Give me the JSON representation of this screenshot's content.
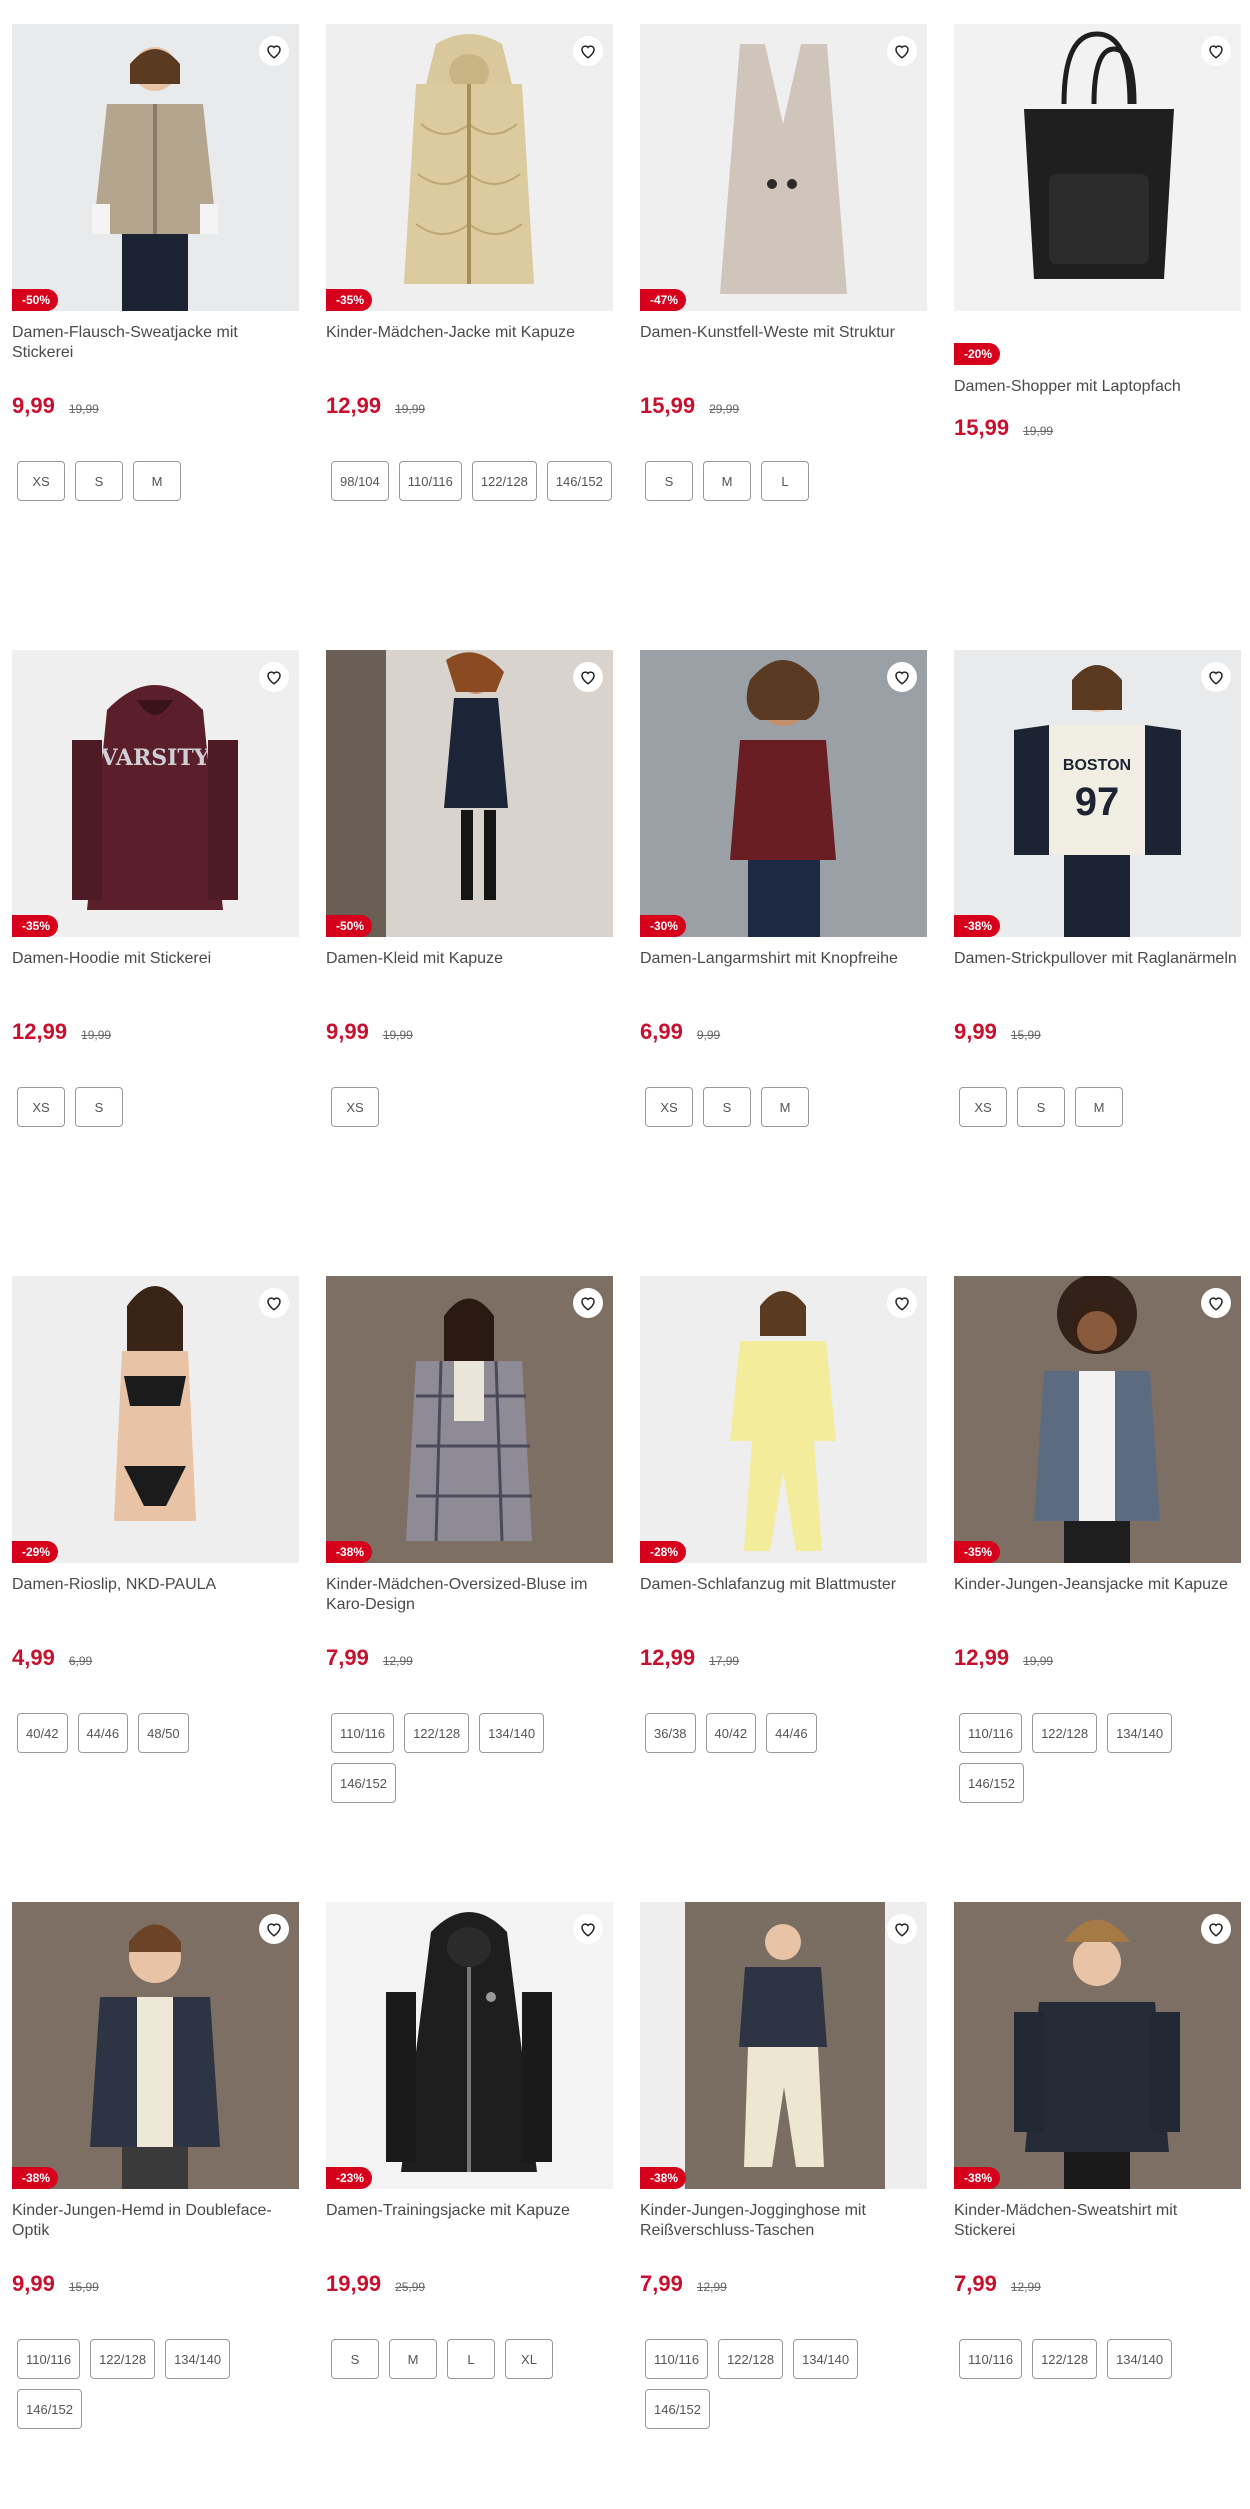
{
  "colors": {
    "sale": "#c8102e",
    "badge": "#d6001c"
  },
  "products": [
    {
      "name": "Damen-Flausch-Sweatjacke mit Stickerei",
      "discount": "-50%",
      "price": "9,99",
      "old_price": "19,99",
      "sizes": [
        "XS",
        "S",
        "M"
      ],
      "bg": "#e9eaec",
      "shape": "jacket-beige"
    },
    {
      "name": "Kinder-Mädchen-Jacke mit Kapuze",
      "discount": "-35%",
      "price": "12,99",
      "old_price": "19,99",
      "sizes": [
        "98/104",
        "110/116",
        "122/128",
        "146/152"
      ],
      "bg": "#efefef",
      "shape": "puffer"
    },
    {
      "name": "Damen-Kunstfell-Weste mit Struktur",
      "discount": "-47%",
      "price": "15,99",
      "old_price": "29,99",
      "sizes": [
        "S",
        "M",
        "L"
      ],
      "bg": "#efefef",
      "shape": "vest"
    },
    {
      "name": "Damen-Shopper mit Laptopfach",
      "discount": "-20%",
      "price": "15,99",
      "old_price": "19,99",
      "sizes": [],
      "bg": "#f2f2f2",
      "shape": "bag"
    },
    {
      "name": "Damen-Hoodie mit Stickerei",
      "discount": "-35%",
      "price": "12,99",
      "old_price": "19,99",
      "sizes": [
        "XS",
        "S"
      ],
      "bg": "#efefef",
      "shape": "hoodie-red"
    },
    {
      "name": "Damen-Kleid mit Kapuze",
      "discount": "-50%",
      "price": "9,99",
      "old_price": "19,99",
      "sizes": [
        "XS"
      ],
      "bg": "#cfcac6",
      "shape": "dress"
    },
    {
      "name": "Damen-Langarmshirt mit Knopfreihe",
      "discount": "-30%",
      "price": "6,99",
      "old_price": "9,99",
      "sizes": [
        "XS",
        "S",
        "M"
      ],
      "bg": "#8a8a8a",
      "shape": "shirt-red"
    },
    {
      "name": "Damen-Strickpullover mit Raglanärmeln",
      "discount": "-38%",
      "price": "9,99",
      "old_price": "15,99",
      "sizes": [
        "XS",
        "S",
        "M"
      ],
      "bg": "#e9eaec",
      "shape": "boston"
    },
    {
      "name": "Damen-Rioslip, NKD-PAULA",
      "discount": "-29%",
      "price": "4,99",
      "old_price": "6,99",
      "sizes": [
        "40/42",
        "44/46",
        "48/50"
      ],
      "bg": "#eeeeee",
      "shape": "lingerie"
    },
    {
      "name": "Kinder-Mädchen-Oversized-Bluse im Karo-Design",
      "discount": "-38%",
      "price": "7,99",
      "old_price": "12,99",
      "sizes": [
        "110/116",
        "122/128",
        "134/140",
        "146/152"
      ],
      "bg": "#7d6f64",
      "shape": "plaid"
    },
    {
      "name": "Damen-Schlafanzug mit Blattmuster",
      "discount": "-28%",
      "price": "12,99",
      "old_price": "17,99",
      "sizes": [
        "36/38",
        "40/42",
        "44/46"
      ],
      "bg": "#eeeeee",
      "shape": "pyjama"
    },
    {
      "name": "Kinder-Jungen-Jeansjacke mit Kapuze",
      "discount": "-35%",
      "price": "12,99",
      "old_price": "19,99",
      "sizes": [
        "110/116",
        "122/128",
        "134/140",
        "146/152"
      ],
      "bg": "#7d6f64",
      "shape": "jeans"
    },
    {
      "name": "Kinder-Jungen-Hemd in Doubleface-Optik",
      "discount": "-38%",
      "price": "9,99",
      "old_price": "15,99",
      "sizes": [
        "110/116",
        "122/128",
        "134/140",
        "146/152"
      ],
      "bg": "#7d6f64",
      "shape": "boy-shirt"
    },
    {
      "name": "Damen-Trainingsjacke mit Kapuze",
      "discount": "-23%",
      "price": "19,99",
      "old_price": "25,99",
      "sizes": [
        "S",
        "M",
        "L",
        "XL"
      ],
      "bg": "#f3f3f3",
      "shape": "track"
    },
    {
      "name": "Kinder-Jungen-Jogginghose mit Reißverschluss-Taschen",
      "discount": "-38%",
      "price": "7,99",
      "old_price": "12,99",
      "sizes": [
        "110/116",
        "122/128",
        "134/140",
        "146/152"
      ],
      "bg": "#7d6f64",
      "shape": "jogger"
    },
    {
      "name": "Kinder-Mädchen-Sweatshirt mit Stickerei",
      "discount": "-38%",
      "price": "7,99",
      "old_price": "12,99",
      "sizes": [
        "110/116",
        "122/128",
        "134/140"
      ],
      "bg": "#7d6f64",
      "shape": "girl-sweat"
    }
  ]
}
